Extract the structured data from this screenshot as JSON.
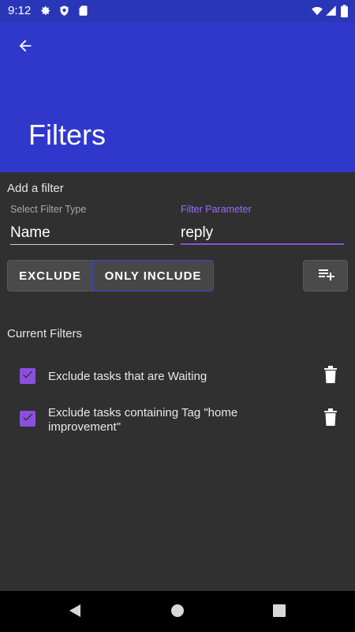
{
  "status_bar": {
    "time": "9:12",
    "icons": [
      "gear-icon",
      "shield-icon",
      "sd-card-icon",
      "wifi-icon",
      "signal-icon",
      "battery-icon"
    ]
  },
  "app_bar": {
    "title": "Filters",
    "back_icon": "arrow-back-icon",
    "color": "#3038cc"
  },
  "add_filter": {
    "heading": "Add a filter",
    "filter_type": {
      "caption": "Select Filter Type",
      "value": "Name"
    },
    "filter_parameter": {
      "caption": "Filter Parameter",
      "value": "reply"
    },
    "mode_toggle": {
      "options": [
        "EXCLUDE",
        "ONLY INCLUDE"
      ],
      "selected": "ONLY INCLUDE"
    },
    "add_button_icon": "playlist-add-icon"
  },
  "current_filters": {
    "heading": "Current Filters",
    "items": [
      {
        "label": "Exclude tasks that are Waiting",
        "checked": true
      },
      {
        "label": "Exclude tasks containing Tag \"home improvement\"",
        "checked": true
      }
    ]
  },
  "nav_bar": {
    "icons": [
      "back-triangle-icon",
      "home-circle-icon",
      "recents-square-icon"
    ]
  },
  "colors": {
    "accent": "#8a4fe0",
    "background": "#303030",
    "primary": "#3038cc"
  }
}
